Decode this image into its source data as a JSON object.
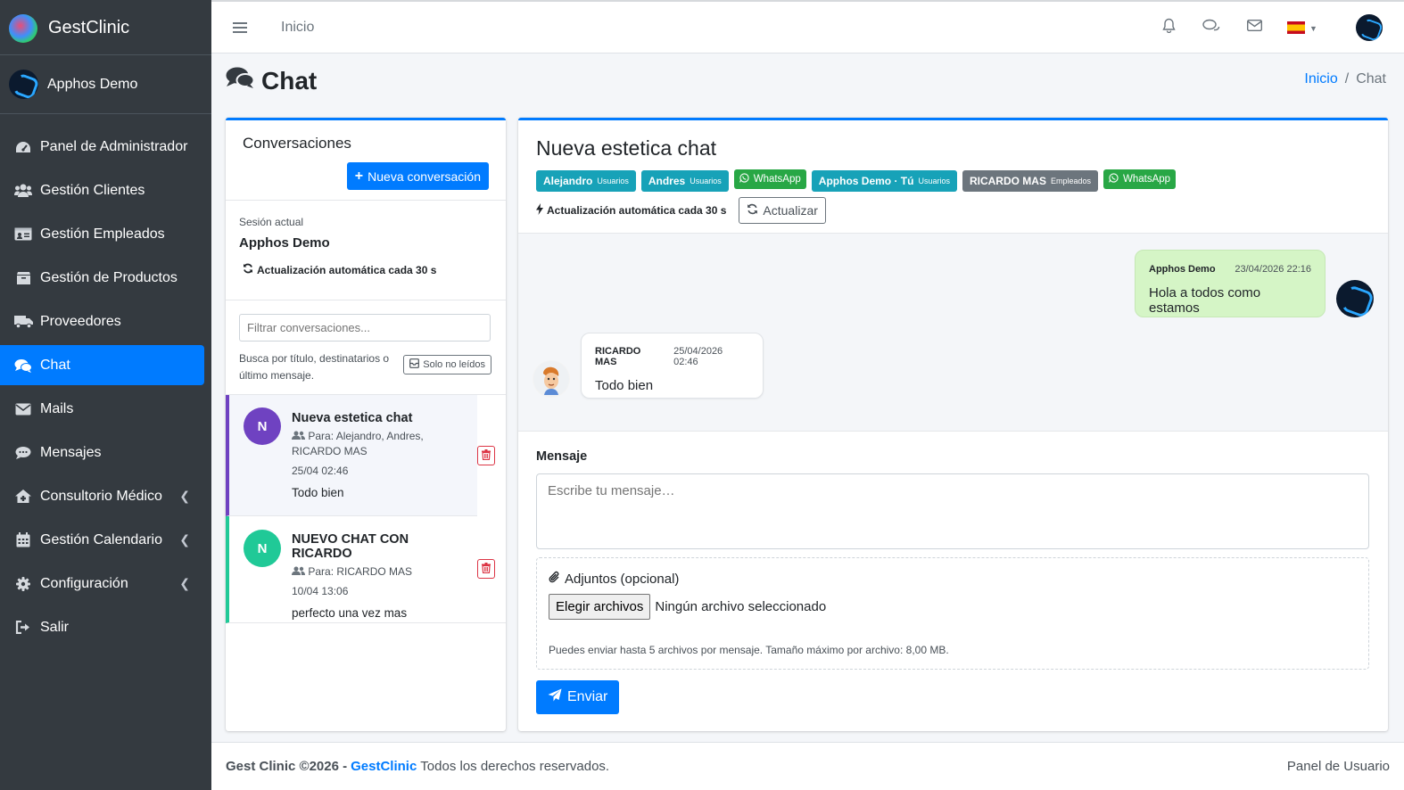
{
  "brand": {
    "name": "GestClinic"
  },
  "user": {
    "name": "Apphos Demo"
  },
  "sidebar": {
    "items": [
      {
        "label": "Panel de Administrador",
        "icon": "gauge-icon"
      },
      {
        "label": "Gestión Clientes",
        "icon": "users-icon"
      },
      {
        "label": "Gestión Empleados",
        "icon": "id-card-icon"
      },
      {
        "label": "Gestión de Productos",
        "icon": "box-icon"
      },
      {
        "label": "Proveedores",
        "icon": "truck-icon"
      },
      {
        "label": "Chat",
        "icon": "comments-icon",
        "active": true
      },
      {
        "label": "Mails",
        "icon": "envelope-icon"
      },
      {
        "label": "Mensajes",
        "icon": "comment-icon"
      },
      {
        "label": "Consultorio Médico",
        "icon": "house-medical-icon",
        "expandable": true
      },
      {
        "label": "Gestión Calendario",
        "icon": "calendar-icon",
        "expandable": true
      },
      {
        "label": "Configuración",
        "icon": "cog-icon",
        "expandable": true
      },
      {
        "label": "Salir",
        "icon": "sign-out-icon"
      }
    ]
  },
  "topbar": {
    "home_link": "Inicio",
    "language": "es"
  },
  "page": {
    "title": "Chat"
  },
  "breadcrumb": {
    "home": "Inicio",
    "sep": "/",
    "current": "Chat"
  },
  "conversations": {
    "title": "Conversaciones",
    "new_button": "Nueva conversación",
    "session_label": "Sesión actual",
    "session_name": "Apphos Demo",
    "auto_update": "Actualización automática cada 30 s",
    "filter_placeholder": "Filtrar conversaciones...",
    "filter_help": "Busca por título, destinatarios o último mensaje.",
    "unread_button": "Solo no leídos",
    "items": [
      {
        "initial": "N",
        "title": "Nueva estetica chat",
        "to": "Para: Alejandro, Andres, RICARDO MAS",
        "date": "25/04 02:46",
        "last": "Todo bien",
        "color": "#6f42c1"
      },
      {
        "initial": "N",
        "title": "NUEVO CHAT CON RICARDO",
        "to": "Para: RICARDO MAS",
        "date": "10/04 13:06",
        "last": "perfecto una vez mas",
        "color": "#20c997"
      }
    ]
  },
  "chat": {
    "title": "Nueva estetica chat",
    "participants": [
      {
        "name": "Alejandro",
        "role": "Usuarios"
      },
      {
        "name": "Andres",
        "role": "Usuarios"
      },
      {
        "whatsapp": "WhatsApp"
      },
      {
        "name": "Apphos Demo · Tú",
        "role": "Usuarios"
      },
      {
        "name": "RICARDO MAS",
        "role": "Empleados"
      },
      {
        "whatsapp": "WhatsApp"
      }
    ],
    "auto_update": "Actualización automática cada 30 s",
    "refresh_button": "Actualizar",
    "messages": [
      {
        "author": "Apphos Demo",
        "time": "23/04/2026 22:16",
        "text": "Hola a todos como estamos",
        "mine": true
      },
      {
        "author": "RICARDO MAS",
        "time": "25/04/2026 02:46",
        "text": "Todo bien",
        "mine": false
      }
    ],
    "compose": {
      "label": "Mensaje",
      "placeholder": "Escribe tu mensaje…",
      "attach_title": "Adjuntos (opcional)",
      "file_button": "Elegir archivos",
      "file_status": "Ningún archivo seleccionado",
      "attach_help": "Puedes enviar hasta 5 archivos por mensaje. Tamaño máximo por archivo: 8,00 MB.",
      "send_button": "Enviar"
    }
  },
  "footer": {
    "copyright": "Gest Clinic ©2026 -",
    "brand_link": "GestClinic",
    "rights": "Todos los derechos reservados.",
    "right_text": "Panel de Usuario"
  },
  "colors": {
    "primary": "#007bff",
    "sidebar": "#343a40",
    "info": "#17a2b8",
    "success": "#28a745",
    "danger": "#dc3545"
  }
}
